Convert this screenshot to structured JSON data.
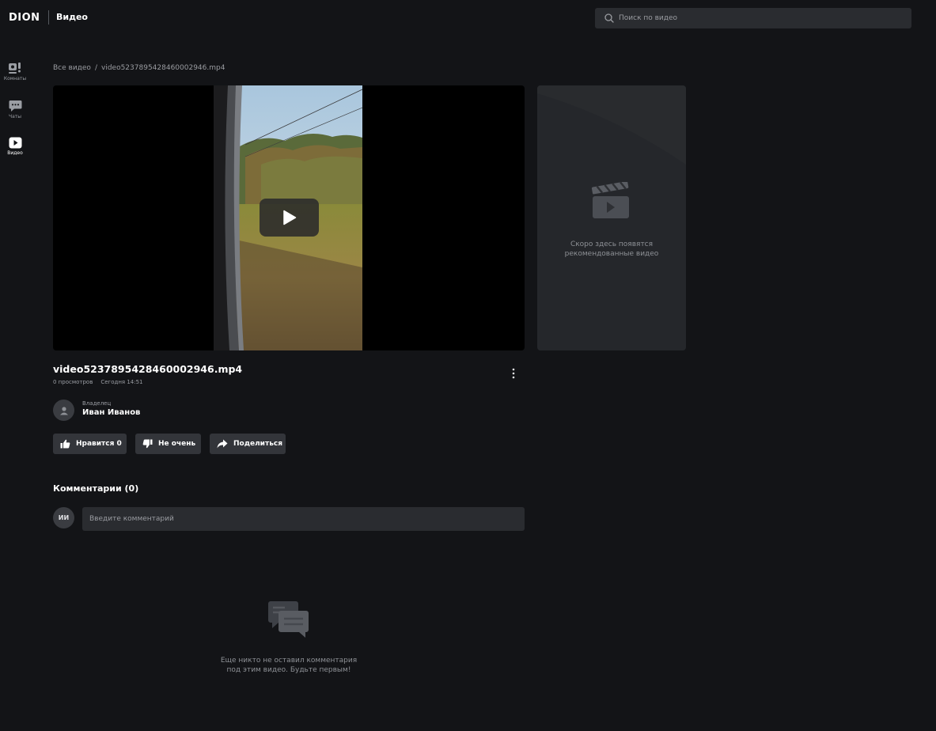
{
  "header": {
    "logo": "DION",
    "section": "Видео",
    "search_placeholder": "Поиск по видео"
  },
  "sidebar": {
    "items": [
      {
        "label": "Комнаты",
        "icon": "rooms-icon",
        "active": false
      },
      {
        "label": "Чаты",
        "icon": "chat-icon",
        "active": false
      },
      {
        "label": "Видео",
        "icon": "video-icon",
        "active": true
      }
    ]
  },
  "breadcrumb": {
    "root": "Все видео",
    "separator": "/",
    "current": "video5237895428460002946.mp4"
  },
  "player": {
    "play_icon": "play-icon"
  },
  "recommendations": {
    "icon": "clapperboard-icon",
    "empty_line1": "Скоро здесь появятся",
    "empty_line2": "рекомендованные видео"
  },
  "video": {
    "title": "video5237895428460002946.mp4",
    "views": "0 просмотров",
    "date": "Сегодня 14:51",
    "owner_label": "Владелец",
    "owner_name": "Иван Иванов"
  },
  "actions": {
    "like_label": "Нравится 0",
    "dislike_label": "Не очень",
    "share_label": "Поделиться"
  },
  "comments": {
    "title": "Комментарии (0)",
    "user_initials": "ИИ",
    "input_placeholder": "Введите комментарий",
    "empty_line1": "Еще никто не оставил комментария",
    "empty_line2": "под этим видео. Будьте первым!"
  },
  "colors": {
    "background": "#131417",
    "panel": "#25272b",
    "input": "#2a2c30",
    "button": "#33353a"
  }
}
